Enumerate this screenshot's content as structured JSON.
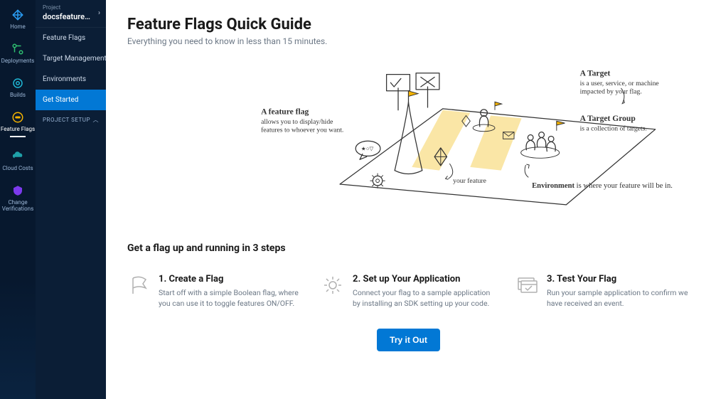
{
  "nav": {
    "items": [
      {
        "label": "Home"
      },
      {
        "label": "Deployments"
      },
      {
        "label": "Builds"
      },
      {
        "label": "Feature Flags"
      },
      {
        "label": "Cloud Costs"
      },
      {
        "label": "Change Verifications"
      }
    ]
  },
  "project": {
    "label": "Project",
    "name": "docsfeatureflag"
  },
  "sidebar": {
    "links": [
      {
        "label": "Feature Flags"
      },
      {
        "label": "Target Management"
      },
      {
        "label": "Environments"
      },
      {
        "label": "Get Started"
      }
    ],
    "section": "PROJECT SETUP"
  },
  "page": {
    "title": "Feature Flags Quick Guide",
    "subtitle": "Everything you need to know in less than 15 minutes."
  },
  "hero": {
    "featureFlag": {
      "title": "A feature flag",
      "line1": "allows you to display/hide",
      "line2": "features to whoever you want."
    },
    "target": {
      "title": "A Target",
      "line1": "is a user, service, or machine",
      "line2": "impacted by your flag."
    },
    "targetGroup": {
      "title": "A Target Group",
      "line1": "is a collection of targets."
    },
    "environment": {
      "prefix": "Environment",
      "suffix": " is where your feature will be in."
    },
    "yourFeature": "your feature"
  },
  "steps": {
    "title": "Get a flag up and running in 3 steps",
    "items": [
      {
        "title": "1. Create a Flag",
        "desc": "Start off with a simple Boolean flag, where you can use it to toggle features ON/OFF."
      },
      {
        "title": "2. Set up Your Application",
        "desc": "Connect your flag to a sample application by installing an SDK setting up your code."
      },
      {
        "title": "3. Test Your Flag",
        "desc": "Run your sample application to confirm we have received an event."
      }
    ]
  },
  "cta": {
    "label": "Try it Out"
  }
}
